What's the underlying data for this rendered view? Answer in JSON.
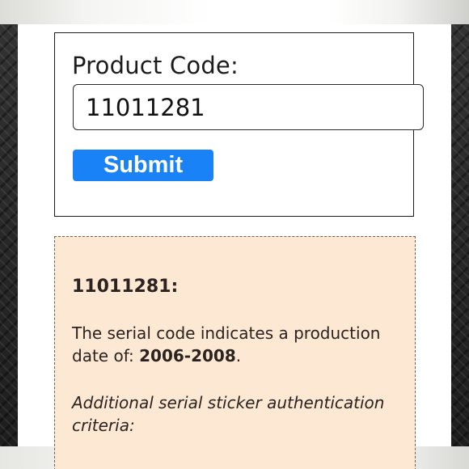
{
  "form": {
    "label": "Product Code:",
    "input_value": "11011281",
    "submit_label": "Submit"
  },
  "result": {
    "code_heading": "11011281:",
    "text_before_date": "The serial code indicates a production date of: ",
    "production_date": "2006-2008",
    "text_after_date": ".",
    "criteria_text": "Additional serial sticker authentication criteria:"
  },
  "colors": {
    "submit_button": "#1a82f7",
    "result_background": "#fce8d3",
    "result_border": "#6b5f55"
  }
}
